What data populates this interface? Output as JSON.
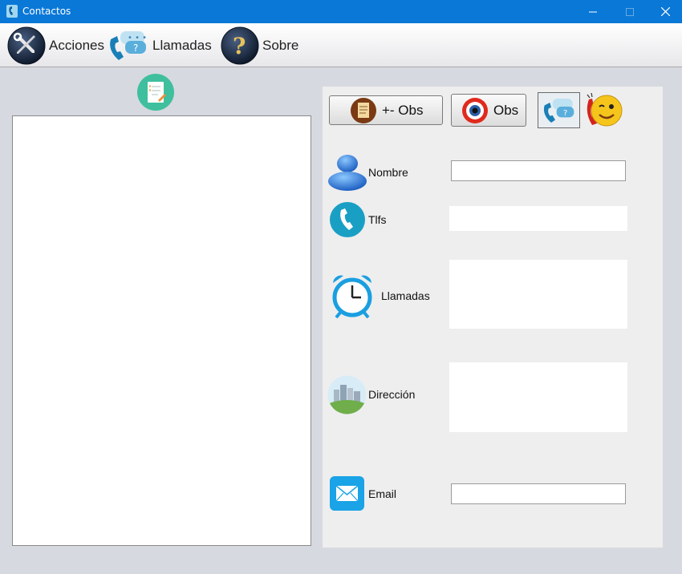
{
  "window": {
    "title": "Contactos",
    "minimize_glyph": "—",
    "maximize_glyph": "☐",
    "close_glyph": "✕"
  },
  "menu": {
    "items": [
      {
        "label": "Acciones",
        "icon": "tools-icon"
      },
      {
        "label": "Llamadas",
        "icon": "phone-chat-icon"
      },
      {
        "label": "Sobre",
        "icon": "help-icon"
      }
    ]
  },
  "toolbar": {
    "edit_obs_label": "+- Obs",
    "view_obs_label": "Obs"
  },
  "form": {
    "nombre": {
      "label": "Nombre",
      "value": ""
    },
    "tlfs": {
      "label": "Tlfs",
      "value": ""
    },
    "llamadas": {
      "label": "Llamadas",
      "value": ""
    },
    "direccion": {
      "label": "Dirección",
      "value": ""
    },
    "email": {
      "label": "Email",
      "value": ""
    }
  },
  "colors": {
    "titlebar": "#0a78d7",
    "panel": "#eeeeee",
    "background": "#d6d9df",
    "accent_teal": "#1a9fc4"
  }
}
